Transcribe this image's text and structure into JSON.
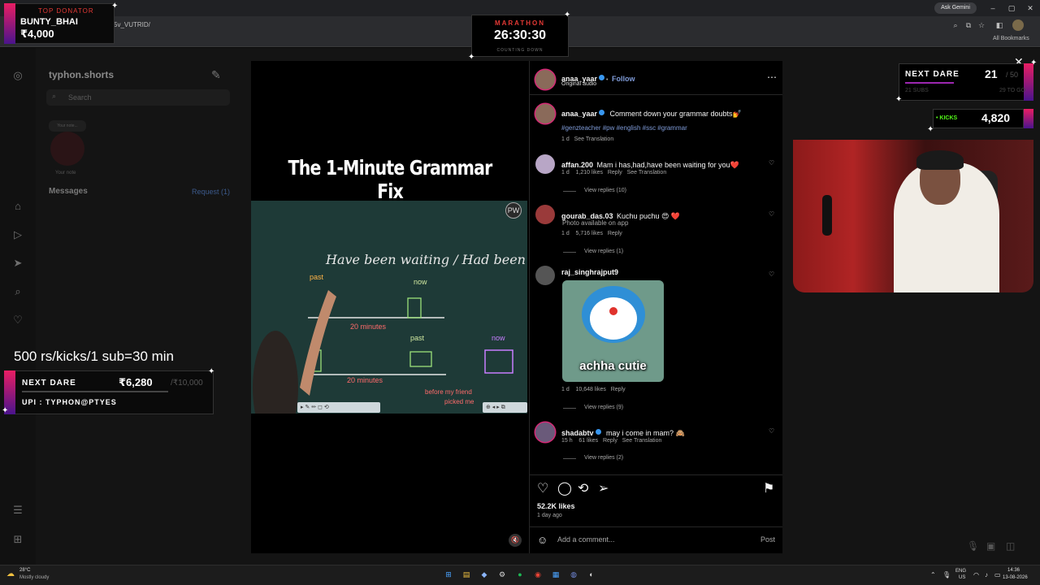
{
  "browser": {
    "ask_gemini": "Ask Gemini",
    "url": "5v_VUTRID/",
    "all_bookmarks": "All Bookmarks",
    "window_controls": [
      "–",
      "▢",
      "✕"
    ]
  },
  "instagram": {
    "username": "typhon.shorts",
    "search_placeholder": "Search",
    "note_bubble": "Your note...",
    "your_note": "Your note",
    "messages_label": "Messages",
    "requests_label": "Request (1)"
  },
  "post": {
    "author": "anaa_yaar",
    "follow_label": "Follow",
    "audio": "Original audio",
    "caption": "Comment down your grammar doubts💅",
    "hashtags": "#genzteacher #pw #english #ssc #grammar",
    "caption_meta": "1 d",
    "see_translation": "See Translation",
    "video_title": "The 1-Minute Grammar Fix",
    "board_logo": "PW",
    "likes": "52.2K likes",
    "posted": "1 day ago",
    "add_comment_placeholder": "Add a comment...",
    "post_label": "Post"
  },
  "comments": [
    {
      "user": "affan.200",
      "text": "Mam i has,had,have been waiting for you❤️",
      "time": "1 d",
      "likes": "1,210 likes",
      "reply": "Reply",
      "translation": "See Translation",
      "view_replies": "View replies (10)"
    },
    {
      "user": "gourab_das.03",
      "text": "Kuchu puchu 😍 ❤️",
      "sub": "Photo available on app",
      "time": "1 d",
      "likes": "5,716 likes",
      "reply": "Reply",
      "view_replies": "View replies (1)"
    },
    {
      "user": "raj_singhrajput9",
      "image_caption": "achha cutie",
      "time": "1 d",
      "likes": "10,648 likes",
      "reply": "Reply",
      "view_replies": "View replies (9)"
    },
    {
      "user": "shadabtv",
      "text": "may i come in mam? 🙈",
      "time": "15 h",
      "likes": "61 likes",
      "reply": "Reply",
      "translation": "See Translation",
      "view_replies": "View replies (2)"
    }
  ],
  "overlays": {
    "donator_label": "TOP DONATOR",
    "donator_name": "BUNTY_BHAI",
    "donator_amount": "₹4,000",
    "marathon_label": "MARATHON",
    "marathon_time": "26:30:30",
    "marathon_sub": "COUNTING DOWN",
    "next_dare_label": "NEXT DARE",
    "next_dare_count": "21",
    "next_dare_goal": "/ 50",
    "next_dare_subs": "21 SUBS",
    "next_dare_togo": "29 TO GO",
    "kicks_label": "• KICKS",
    "kicks_count": "4,820",
    "rate_text": "500 rs/kicks/1 sub=30 min",
    "next_dare_left_label": "NEXT DARE",
    "next_dare_left_amount": "₹6,280",
    "next_dare_left_goal": "/₹10,000",
    "upi": "UPI : TYPHON@PTYES"
  },
  "taskbar": {
    "temp": "28°C",
    "weather": "Mostly cloudy",
    "lang": "ENG",
    "region": "US",
    "time": "14:36",
    "date": "13-08-2026"
  }
}
